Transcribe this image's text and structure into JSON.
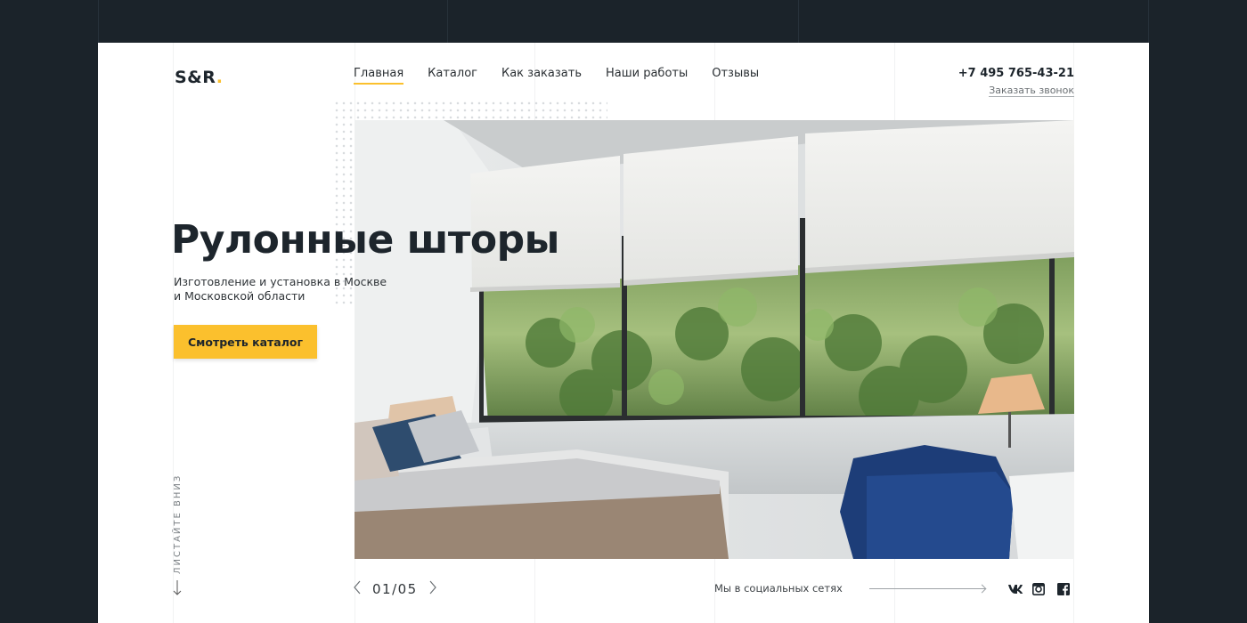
{
  "brand": {
    "logo_text": "S&R",
    "logo_dot": ".",
    "accent": "#fbc02d",
    "dark": "#1d252c"
  },
  "nav": {
    "items": [
      "Главная",
      "Каталог",
      "Как заказать",
      "Наши работы",
      "Отзывы"
    ],
    "active": "Главная"
  },
  "contact": {
    "phone": "+7 495 765-43-21",
    "callback": "Заказать звонок"
  },
  "hero": {
    "title": "Рулонные шторы",
    "subtitle_line1": "Изготовление и установка в Москве",
    "subtitle_line2": "и Московской области",
    "cta": "Смотреть каталог"
  },
  "scroll": {
    "label": "ЛИСТАЙТЕ ВНИЗ",
    "icon": "arrow-down-icon"
  },
  "slider": {
    "counter": "01/05",
    "prev_icon": "chevron-left-icon",
    "next_icon": "chevron-right-icon"
  },
  "social": {
    "label": "Мы в социальных сетях",
    "icons": [
      "vk-icon",
      "instagram-icon",
      "facebook-icon"
    ]
  }
}
